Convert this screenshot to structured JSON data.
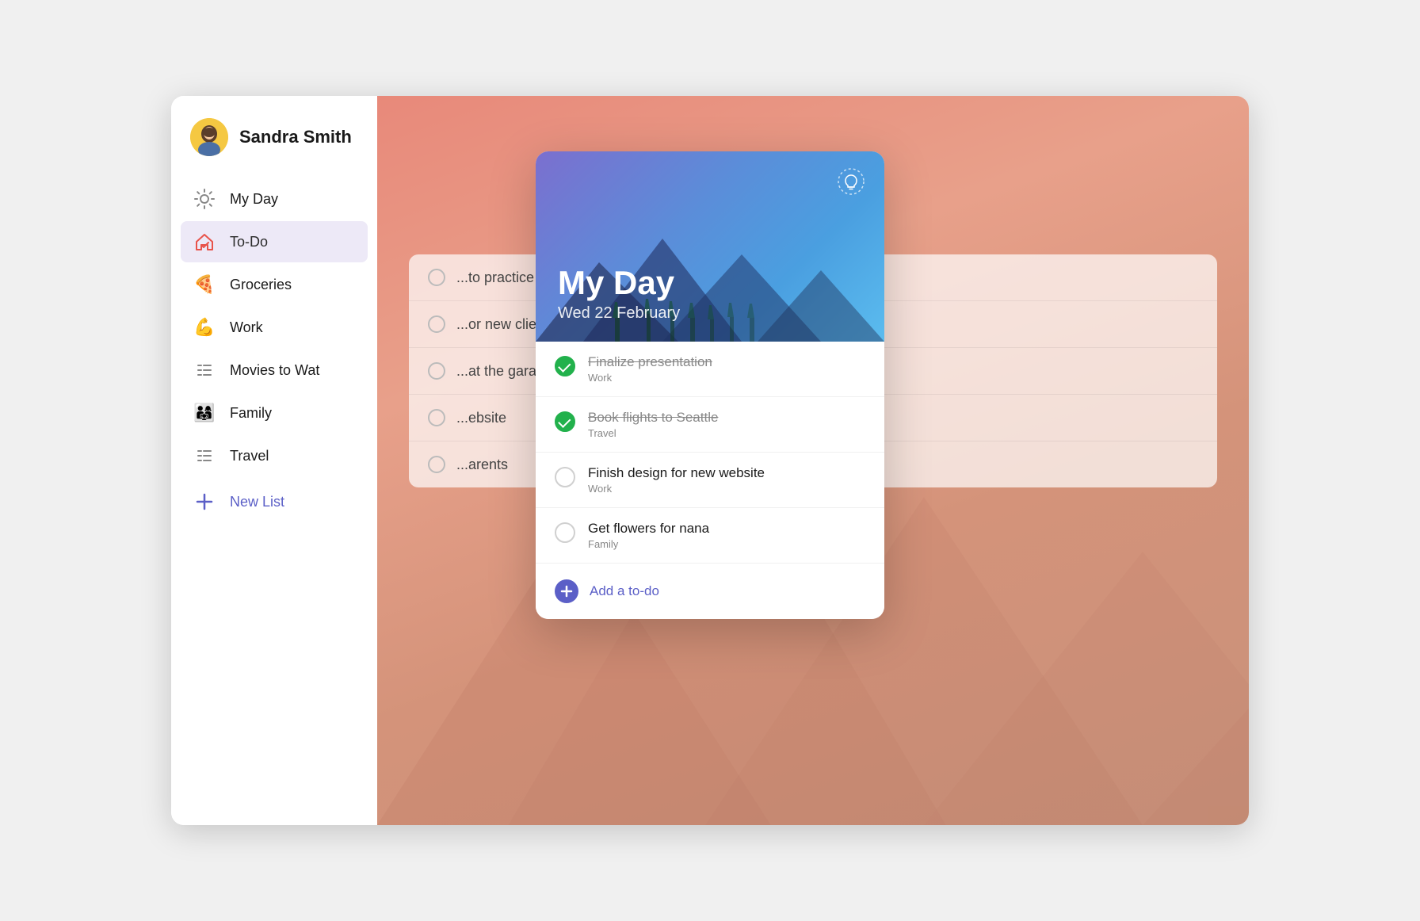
{
  "user": {
    "name": "Sandra Smith"
  },
  "sidebar": {
    "items": [
      {
        "id": "my-day",
        "label": "My Day",
        "icon": "sun"
      },
      {
        "id": "todo",
        "label": "To-Do",
        "icon": "house-check",
        "active": true
      },
      {
        "id": "groceries",
        "label": "Groceries",
        "icon": "pizza"
      },
      {
        "id": "work",
        "label": "Work",
        "icon": "muscle"
      },
      {
        "id": "movies",
        "label": "Movies to Wat",
        "icon": "list"
      },
      {
        "id": "family",
        "label": "Family",
        "icon": "family"
      },
      {
        "id": "travel",
        "label": "Travel",
        "icon": "list"
      },
      {
        "id": "new-list",
        "label": "New List",
        "icon": "plus"
      }
    ],
    "new_list_label": "New List"
  },
  "panel": {
    "title": "My Day",
    "date": "Wed 22 February",
    "lightbulb_icon": "💡",
    "tasks": [
      {
        "id": 1,
        "title": "Finalize presentation",
        "category": "Work",
        "completed": true
      },
      {
        "id": 2,
        "title": "Book flights to Seattle",
        "category": "Travel",
        "completed": true
      },
      {
        "id": 3,
        "title": "Finish design for new website",
        "category": "Work",
        "completed": false
      },
      {
        "id": 4,
        "title": "Get flowers for nana",
        "category": "Family",
        "completed": false
      }
    ],
    "add_label": "Add a to-do"
  },
  "bg_tasks": [
    {
      "text": "...to practice",
      "done": false
    },
    {
      "text": "...or new clients",
      "done": false
    },
    {
      "text": "...at the garage",
      "done": false
    },
    {
      "text": "...ebsite",
      "done": false
    },
    {
      "text": "...arents",
      "done": false
    }
  ]
}
